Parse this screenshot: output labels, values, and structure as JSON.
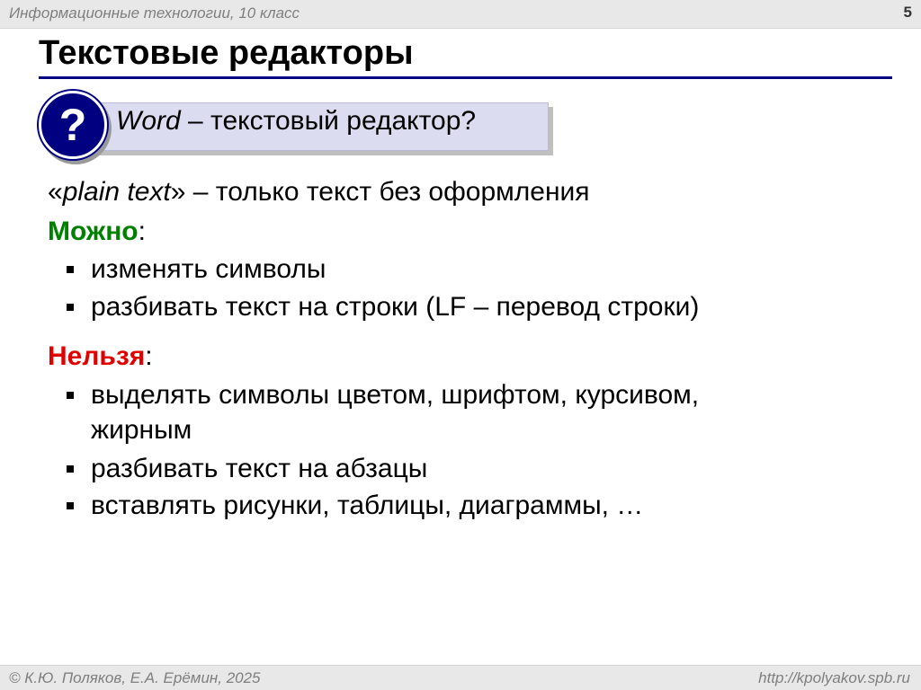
{
  "header": {
    "course": "Информационные технологии, 10 класс",
    "slide_number": "5"
  },
  "title": "Текстовые редакторы",
  "question": {
    "icon": "question-icon",
    "icon_glyph": "?",
    "word": "Word",
    "rest": " – текстовый редактор?"
  },
  "plain_text": {
    "open_quote": "«",
    "term": "plain text",
    "rest": "» – только  текст без оформления"
  },
  "can": {
    "heading": "Можно",
    "colon": ":",
    "items": [
      "изменять символы",
      "разбивать текст на строки (LF – перевод строки)"
    ]
  },
  "cannot": {
    "heading": "Нельзя",
    "colon": ":",
    "items": [
      "выделять символы цветом, шрифтом, курсивом,",
      "жирным",
      "разбивать текст на абзацы",
      "вставлять рисунки, таблицы, диаграммы, …"
    ]
  },
  "footer": {
    "authors": "© К.Ю. Поляков, Е.А. Ерёмин, 2025",
    "site": "http://kpolyakov.spb.ru"
  },
  "colors": {
    "accent": "#000080",
    "green": "#008000",
    "red": "#e00000",
    "bar": "#e8e8e8",
    "muted_text": "#7f7f7f"
  }
}
